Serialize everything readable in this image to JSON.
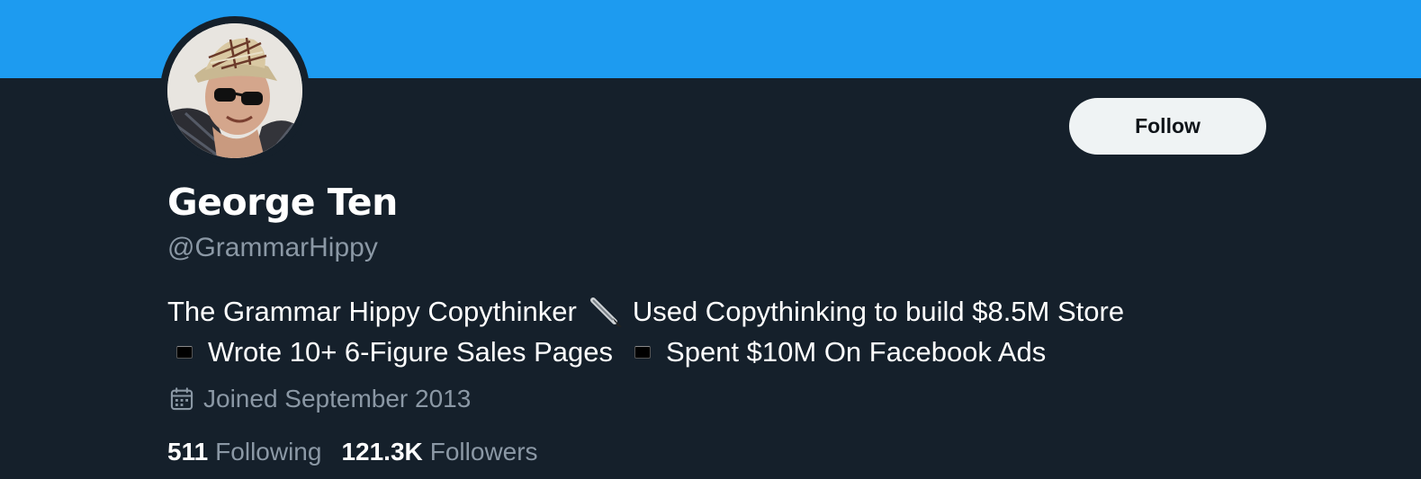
{
  "profile": {
    "name": "George Ten",
    "handle": "@GrammarHippy",
    "bio_line1_a": "The Grammar Hippy Copythinker",
    "bio_line1_b": "Used Copythinking to build $8.5M Store",
    "bio_line2_a": "Wrote 10+ 6-Figure Sales Pages",
    "bio_line2_b": "Spent $10M On Facebook Ads",
    "joined": "Joined September 2013"
  },
  "actions": {
    "follow_label": "Follow"
  },
  "stats": {
    "following_count": "511",
    "following_label": "Following",
    "followers_count": "121.3K",
    "followers_label": "Followers"
  },
  "colors": {
    "banner": "#1d9bf0",
    "background": "#15202b",
    "secondary_text": "#8b98a5",
    "button_bg": "#eff3f4"
  },
  "icons": {
    "bio_pen": "fountain-pen-icon",
    "bio_bullet": "black-square-icon",
    "joined": "calendar-icon"
  }
}
